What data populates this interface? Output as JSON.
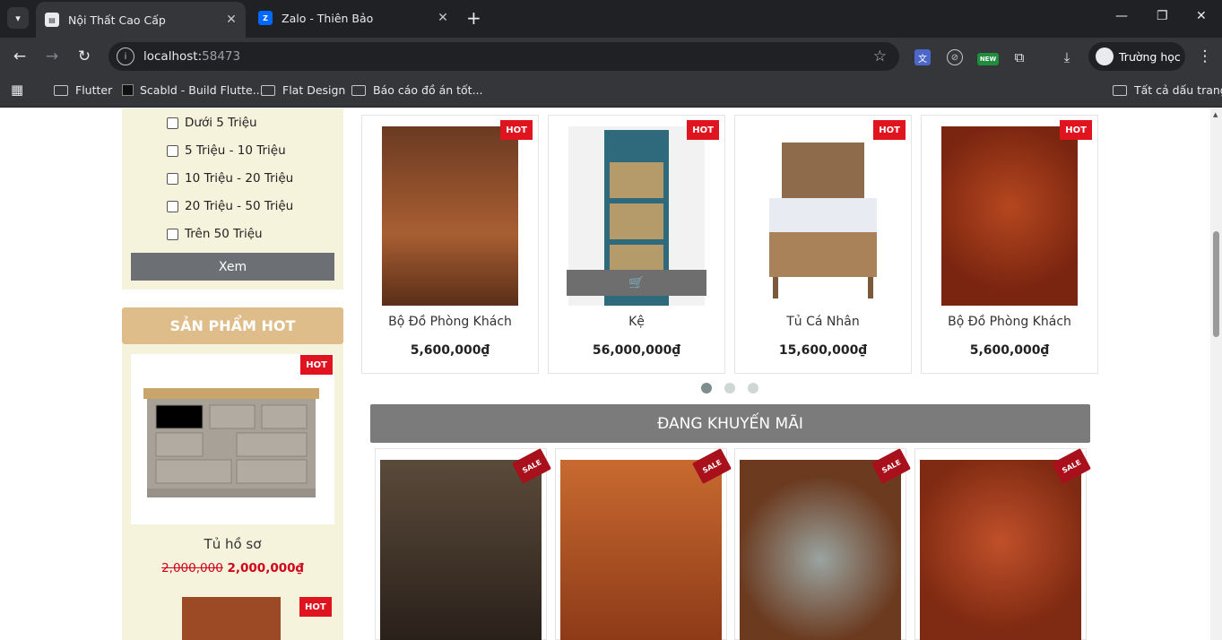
{
  "browser": {
    "tabs": [
      {
        "title": "Nội Thất Cao Cấp",
        "favicon": "document-icon",
        "active": true
      },
      {
        "title": "Zalo - Thiên Bảo",
        "favicon": "zalo-icon",
        "active": false
      }
    ],
    "address": {
      "host": "localhost:",
      "port": "58473"
    },
    "profile_name": "Trường học",
    "ext_badge": "NEW",
    "bookmarks": [
      {
        "label": "Flutter",
        "icon": "folder-icon"
      },
      {
        "label": "Scabld - Build Flutte...",
        "icon": "scabld-icon"
      },
      {
        "label": "Flat Design",
        "icon": "folder-icon"
      },
      {
        "label": "Báo cáo đồ án tốt...",
        "icon": "folder-icon"
      }
    ],
    "all_bookmarks": "Tất cả dấu trang"
  },
  "filter": {
    "options": [
      "Dưới 5 Triệu",
      "5 Triệu - 10 Triệu",
      "10 Triệu - 20 Triệu",
      "20 Triệu - 50 Triệu",
      "Trên 50 Triệu"
    ],
    "button": "Xem"
  },
  "hot_sidebar": {
    "header": "SẢN PHẨM HOT",
    "badge": "HOT",
    "product": {
      "name": "Tủ hồ sơ",
      "old_price": "2,000,000",
      "price": "2,000,000₫"
    },
    "next_badge": "HOT"
  },
  "hot_products": [
    {
      "name": "Bộ Đồ Phòng Khách",
      "price": "5,600,000₫",
      "badge": "HOT",
      "color": "#9a5530"
    },
    {
      "name": "Kệ",
      "price": "56,000,000₫",
      "badge": "HOT",
      "color": "#2f6a7c"
    },
    {
      "name": "Tủ Cá Nhân",
      "price": "15,600,000₫",
      "badge": "HOT",
      "color": "#a9825a"
    },
    {
      "name": "Bộ Đồ Phòng Khách",
      "price": "5,600,000₫",
      "badge": "HOT",
      "color": "#8c2d14"
    }
  ],
  "carousel_dots": 3,
  "promo": {
    "title": "ĐANG KHUYẾN MÃI",
    "badge": "SALE",
    "items": [
      {
        "color": "#3a2a22"
      },
      {
        "color": "#b24f1e"
      },
      {
        "color": "#6b3a1f"
      },
      {
        "color": "#a0361a"
      }
    ]
  }
}
